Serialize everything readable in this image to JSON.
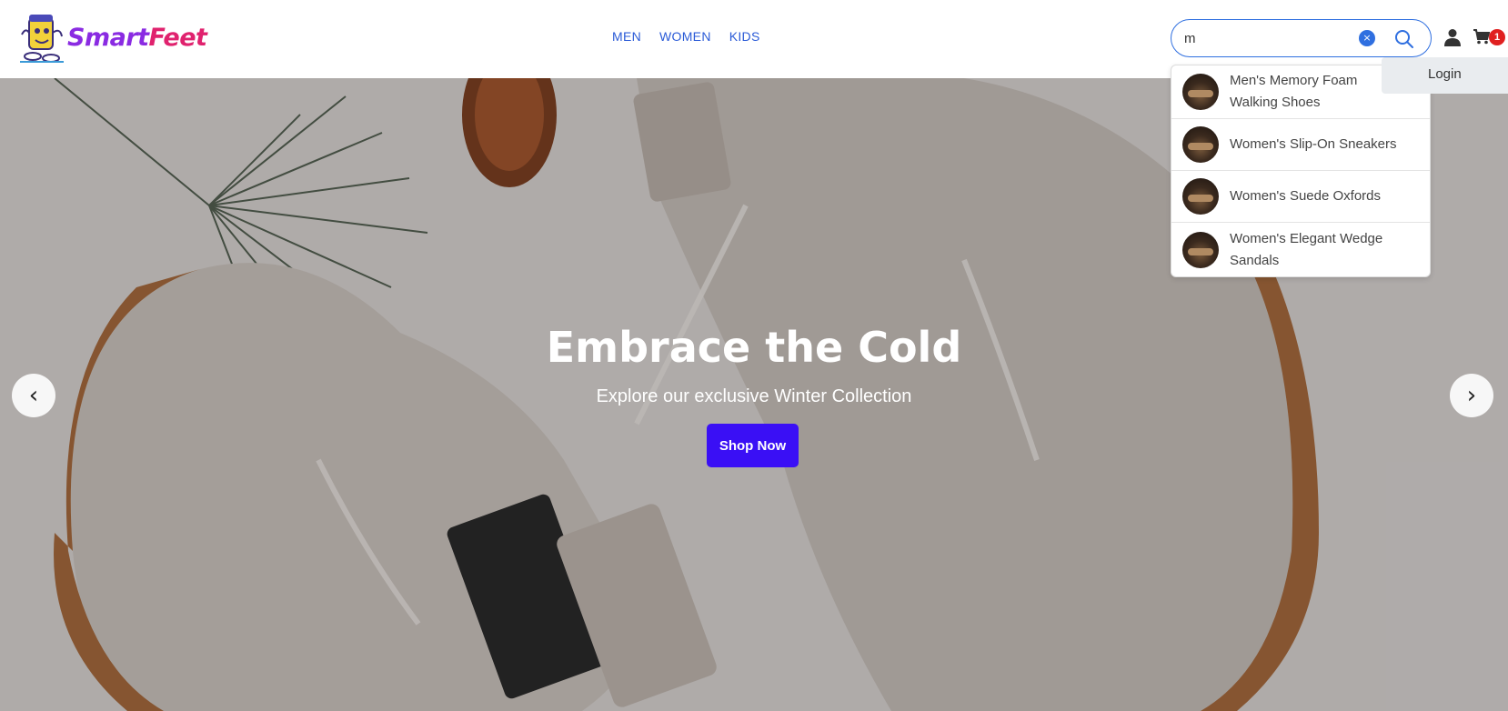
{
  "brand": {
    "name_part1": "Smart",
    "name_part2": "Feet"
  },
  "nav": {
    "items": [
      {
        "label": "MEN"
      },
      {
        "label": "WOMEN"
      },
      {
        "label": "KIDS"
      }
    ]
  },
  "search": {
    "value": "m",
    "clear_glyph": "×"
  },
  "cart": {
    "count": "1"
  },
  "user_menu": {
    "login_label": "Login"
  },
  "suggestions": [
    {
      "label": "Men's Memory Foam Walking Shoes"
    },
    {
      "label": "Women's Slip-On Sneakers"
    },
    {
      "label": "Women's Suede Oxfords"
    },
    {
      "label": "Women's Elegant Wedge Sandals"
    }
  ],
  "hero": {
    "title": "Embrace the Cold",
    "subtitle": "Explore our exclusive Winter Collection",
    "cta_label": "Shop Now",
    "prev_glyph": "‹",
    "next_glyph": "›"
  },
  "colors": {
    "accent": "#2b5bd7",
    "cta": "#3a0ff5",
    "brand_purple": "#8a2be2",
    "brand_pink": "#e0226e",
    "badge": "#e02020"
  },
  "icons": [
    "logo-mascot-icon",
    "clear-search-icon",
    "search-icon",
    "user-icon",
    "cart-icon",
    "chevron-left-icon",
    "chevron-right-icon"
  ]
}
